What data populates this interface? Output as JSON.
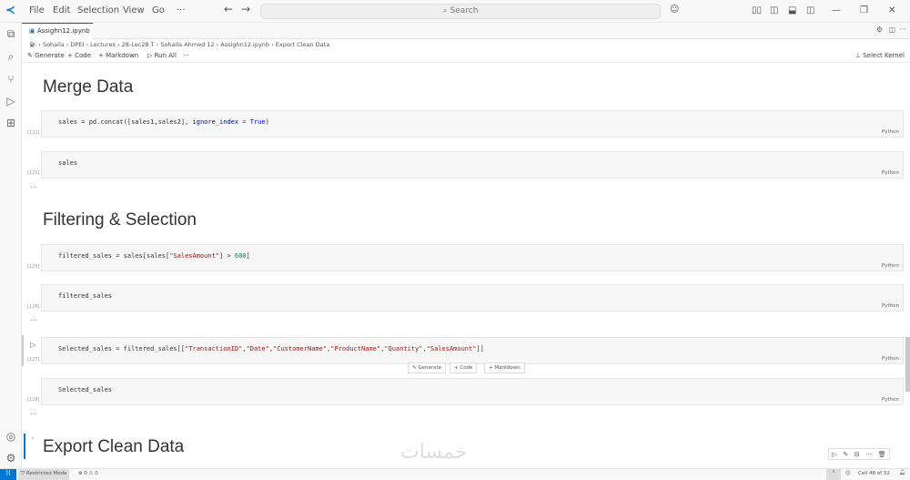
{
  "menu": [
    "File",
    "Edit",
    "Selection",
    "View",
    "Go",
    "···"
  ],
  "search_placeholder": "Search",
  "tab": "Assighn12.ipynb",
  "breadcrumb": [
    "D:",
    "Sohaila",
    "DPEI",
    "Lectures",
    "28-Lec28 T",
    "Sohaila Ahmed 12",
    "Assighn12.ipynb",
    "Export Clean Data"
  ],
  "toolbar": {
    "generate": "Generate",
    "code": "+ Code",
    "markdown": "+ Markdown",
    "run_all": "Run All",
    "more": "···",
    "kernel": "Select Kernel"
  },
  "headings": [
    "Merge Data",
    "Filtering & Selection",
    "Export Clean Data"
  ],
  "cells": [
    {
      "count": "[121]",
      "lang": "Python"
    },
    {
      "count": "[122]",
      "code": "sales",
      "lang": "Python"
    },
    {
      "count": "[125]",
      "lang": "Python"
    },
    {
      "count": "[126]",
      "code": "filtered_sales",
      "lang": "Python"
    },
    {
      "count": "[127]",
      "lang": "Python"
    },
    {
      "count": "[128]",
      "code": "Selected_sales",
      "lang": "Python"
    }
  ],
  "code1": {
    "a": "sales = pd.concat([sales1,sales2], ",
    "b": "ignore_index",
    "c": " = ",
    "d": "True",
    ")": ")"
  },
  "code3": {
    "a": "filtered_sales = sales[sales[",
    "b": "\"SalesAmount\"",
    "c": "] > ",
    "d": "600",
    "e": "]"
  },
  "code5": {
    "a": "Selected_sales = filtered_sales[[",
    "b": "\"TransactionID\"",
    ",1": ",",
    "c": "\"Date\"",
    ",2": ",",
    "d": "\"CustomerName\"",
    ",3": ",",
    "e": "\"ProductName\"",
    ",4": ",",
    "f": "\"Quantity\"",
    ",5": ",",
    "g": "\"SalesAmount\"",
    "h": "]]"
  },
  "insert": {
    "generate": "Generate",
    "code": "+ Code",
    "markdown": "+ Markdown"
  },
  "ellipsis": "…",
  "status": {
    "mode": "Restricted Mode",
    "problems": "⊗ 0 ⚠ 0",
    "cell": "Cell 48 of 52"
  },
  "watermark": "خمسات"
}
